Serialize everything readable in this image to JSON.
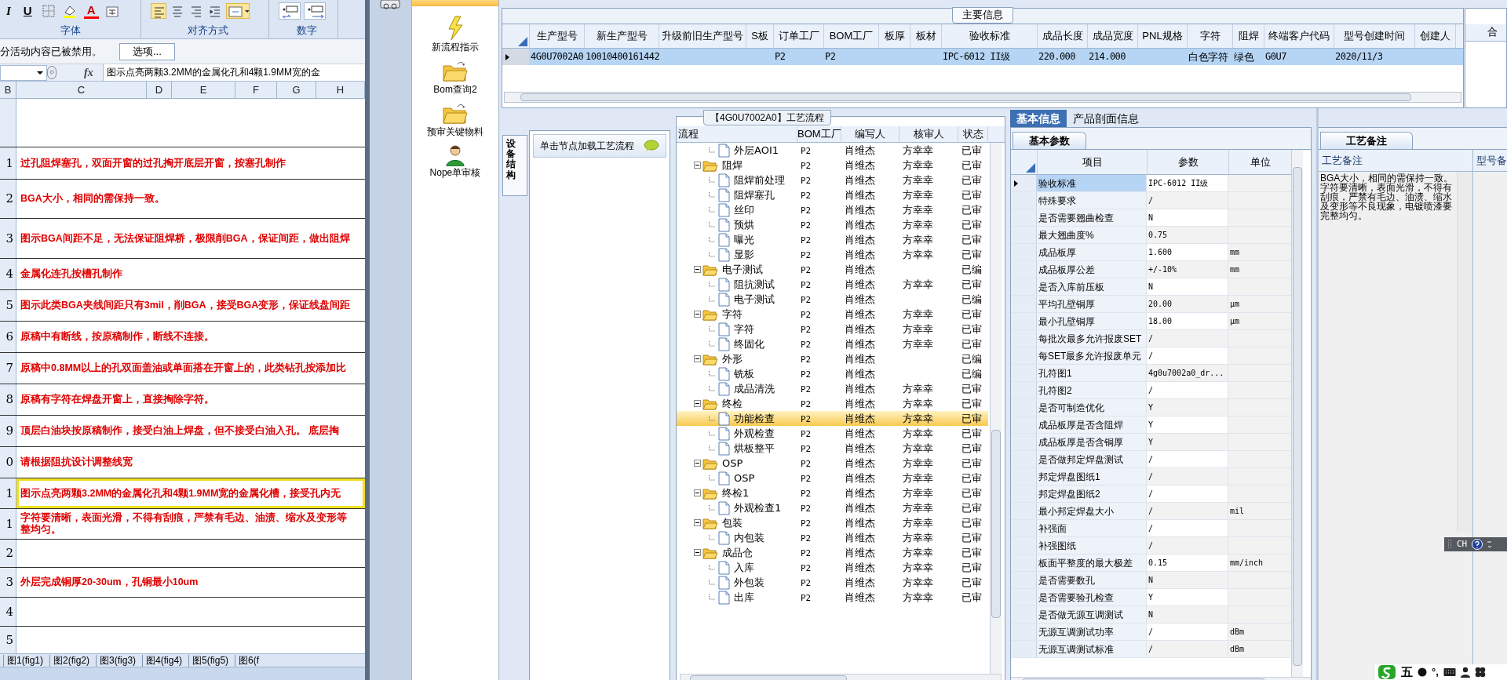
{
  "excel": {
    "format_buttons": [
      "I",
      "U",
      "A"
    ],
    "ribbon_groups": [
      "字体",
      "对齐方式",
      "数字"
    ],
    "security_bar": {
      "message": "分活动内容已被禁用。",
      "button": "选项..."
    },
    "formula_bar": {
      "function_label": "fx",
      "content": "图示点亮两颗3.2MM的金属化孔和4颗1.9MM宽的金"
    },
    "columns": [
      "B",
      "C",
      "D",
      "E",
      "F",
      "G",
      "H"
    ],
    "rows": [
      {
        "header": "",
        "lines": [],
        "selected": false
      },
      {
        "header": "1",
        "lines": [
          "过孔阻焊塞孔，双面开窗的过孔掏开底层开窗，按塞孔制作"
        ],
        "selected": false
      },
      {
        "header": "2",
        "lines": [
          "BGA大小，相同的需保持一致。"
        ],
        "selected": false
      },
      {
        "header": "3",
        "lines": [
          "图示BGA间距不足，无法保证阻焊桥，极限削BGA，保证间距，做出阻焊"
        ],
        "selected": false
      },
      {
        "header": "4",
        "lines": [
          "金属化连孔按槽孔制作"
        ],
        "selected": false
      },
      {
        "header": "5",
        "lines": [
          "图示此类BGA夹线间距只有3mil，削BGA，接受BGA变形，保证线盘间距"
        ],
        "selected": false
      },
      {
        "header": "6",
        "lines": [
          "原稿中有断线，按原稿制作，断线不连接。"
        ],
        "selected": false
      },
      {
        "header": "7",
        "lines": [
          "原稿中0.8MM以上的孔双面盖油或单面搭在开窗上的，此类钻孔按添加比"
        ],
        "selected": false
      },
      {
        "header": "8",
        "lines": [
          "原稿有字符在焊盘开窗上，直接掏除字符。"
        ],
        "selected": false
      },
      {
        "header": "9",
        "lines": [
          "顶层白油块按原稿制作，接受白油上焊盘，但不接受白油入孔。 底层掏"
        ],
        "selected": false
      },
      {
        "header": "0",
        "lines": [
          "请根据阻抗设计调整线宽"
        ],
        "selected": false
      },
      {
        "header": "1",
        "lines": [
          "图示点亮两颗3.2MM的金属化孔和4颗1.9MM宽的金属化槽，接受孔内无"
        ],
        "selected": true
      },
      {
        "header": "1",
        "lines": [
          "字符要清晰，表面光滑，不得有刮痕，严禁有毛边、油渍、缩水及变形等",
          "整均匀。"
        ],
        "selected": false
      },
      {
        "header": "2",
        "lines": [],
        "selected": false
      },
      {
        "header": "3",
        "lines": [
          "外层完成铜厚20-30um，孔铜最小10um"
        ],
        "selected": false
      },
      {
        "header": "4",
        "lines": [],
        "selected": false
      },
      {
        "header": "5",
        "lines": [],
        "selected": false
      }
    ],
    "sheet_tabs": [
      "图1(fig1)",
      "图2(fig2)",
      "图3(fig3)",
      "图4(fig4)",
      "图5(fig5)",
      "图6(f"
    ]
  },
  "nav": {
    "items": [
      {
        "label": "新流程指示",
        "kind": "lightning"
      },
      {
        "label": "Bom查询2",
        "kind": "folder"
      },
      {
        "label": "预审关键物料",
        "kind": "folder"
      },
      {
        "label": "Nope单审核",
        "kind": "person"
      }
    ]
  },
  "main_info": {
    "title": "主要信息",
    "columns": [
      "生产型号",
      "新生产型号",
      "升级前旧生产型号",
      "S板",
      "订单工厂",
      "BOM工厂",
      "板厚",
      "板材",
      "验收标准",
      "成品长度",
      "成品宽度",
      "PNL规格",
      "字符",
      "阻焊",
      "终端客户代码",
      "型号创建时间",
      "创建人"
    ],
    "rows": [
      {
        "cells": [
          "4G0U7002A0",
          "10010400161442",
          "",
          "",
          "P2",
          "P2",
          "",
          "",
          "IPC-6012 II级",
          "220.000",
          "214.000",
          "",
          "白色字符",
          "绿色",
          "G0U7",
          "2020/11/3",
          ""
        ],
        "selected": true
      }
    ],
    "side_header": "合"
  },
  "process_panel": {
    "vertical_tab": "设备结构",
    "hint": "单击节点加载工艺流程"
  },
  "process_flow": {
    "title": "【4G0U7002A0】工艺流程",
    "columns": [
      "流程",
      "BOM工厂",
      "编写人",
      "核审人",
      "状态"
    ],
    "nodes": [
      {
        "children": [
          {
            "label": "外层AOI1",
            "bom": "P2",
            "writer": "肖维杰",
            "reviewer": "方幸幸",
            "status": "已审",
            "selected": false
          }
        ]
      },
      {
        "label": "阻焊",
        "bom": "P2",
        "writer": "肖维杰",
        "reviewer": "方幸幸",
        "status": "已审",
        "selected": false,
        "expanded": true,
        "children": [
          {
            "label": "阻焊前处理",
            "bom": "P2",
            "writer": "肖维杰",
            "reviewer": "方幸幸",
            "status": "已审",
            "selected": false
          },
          {
            "label": "阻焊塞孔",
            "bom": "P2",
            "writer": "肖维杰",
            "reviewer": "方幸幸",
            "status": "已审",
            "selected": false
          },
          {
            "label": "丝印",
            "bom": "P2",
            "writer": "肖维杰",
            "reviewer": "方幸幸",
            "status": "已审",
            "selected": false
          },
          {
            "label": "预烘",
            "bom": "P2",
            "writer": "肖维杰",
            "reviewer": "方幸幸",
            "status": "已审",
            "selected": false
          },
          {
            "label": "曝光",
            "bom": "P2",
            "writer": "肖维杰",
            "reviewer": "方幸幸",
            "status": "已审",
            "selected": false
          },
          {
            "label": "显影",
            "bom": "P2",
            "writer": "肖维杰",
            "reviewer": "方幸幸",
            "status": "已审",
            "selected": false
          }
        ]
      },
      {
        "label": "电子测试",
        "bom": "P2",
        "writer": "肖维杰",
        "status": "已编",
        "selected": false,
        "expanded": true,
        "children": [
          {
            "label": "阻抗测试",
            "bom": "P2",
            "writer": "肖维杰",
            "reviewer": "方幸幸",
            "status": "已审",
            "selected": false
          },
          {
            "label": "电子测试",
            "bom": "P2",
            "writer": "肖维杰",
            "status": "已编",
            "selected": false
          }
        ]
      },
      {
        "label": "字符",
        "bom": "P2",
        "writer": "肖维杰",
        "reviewer": "方幸幸",
        "status": "已审",
        "selected": false,
        "expanded": true,
        "children": [
          {
            "label": "字符",
            "bom": "P2",
            "writer": "肖维杰",
            "reviewer": "方幸幸",
            "status": "已审",
            "selected": false
          },
          {
            "label": "终固化",
            "bom": "P2",
            "writer": "肖维杰",
            "reviewer": "方幸幸",
            "status": "已审",
            "selected": false
          }
        ]
      },
      {
        "label": "外形",
        "bom": "P2",
        "writer": "肖维杰",
        "status": "已编",
        "selected": false,
        "expanded": true,
        "children": [
          {
            "label": "铣板",
            "bom": "P2",
            "writer": "肖维杰",
            "status": "已编",
            "selected": false
          },
          {
            "label": "成品清洗",
            "bom": "P2",
            "writer": "肖维杰",
            "reviewer": "方幸幸",
            "status": "已审",
            "selected": false
          }
        ]
      },
      {
        "label": "终检",
        "bom": "P2",
        "writer": "肖维杰",
        "reviewer": "方幸幸",
        "status": "已审",
        "selected": false,
        "expanded": true,
        "children": [
          {
            "label": "功能检查",
            "bom": "P2",
            "writer": "肖维杰",
            "reviewer": "方幸幸",
            "status": "已审",
            "selected": true
          },
          {
            "label": "外观检查",
            "bom": "P2",
            "writer": "肖维杰",
            "reviewer": "方幸幸",
            "status": "已审",
            "selected": false
          },
          {
            "label": "烘板整平",
            "bom": "P2",
            "writer": "肖维杰",
            "reviewer": "方幸幸",
            "status": "已审",
            "selected": false
          }
        ]
      },
      {
        "label": "OSP",
        "bom": "P2",
        "writer": "肖维杰",
        "reviewer": "方幸幸",
        "status": "已审",
        "selected": false,
        "expanded": true,
        "children": [
          {
            "label": "OSP",
            "bom": "P2",
            "writer": "肖维杰",
            "reviewer": "方幸幸",
            "status": "已审",
            "selected": false
          }
        ]
      },
      {
        "label": "终检1",
        "bom": "P2",
        "writer": "肖维杰",
        "reviewer": "方幸幸",
        "status": "已审",
        "selected": false,
        "expanded": true,
        "children": [
          {
            "label": "外观检查1",
            "bom": "P2",
            "writer": "肖维杰",
            "reviewer": "方幸幸",
            "status": "已审",
            "selected": false
          }
        ]
      },
      {
        "label": "包装",
        "bom": "P2",
        "writer": "肖维杰",
        "reviewer": "方幸幸",
        "status": "已审",
        "selected": false,
        "expanded": true,
        "children": [
          {
            "label": "内包装",
            "bom": "P2",
            "writer": "肖维杰",
            "reviewer": "方幸幸",
            "status": "已审",
            "selected": false
          }
        ]
      },
      {
        "label": "成品仓",
        "bom": "P2",
        "writer": "肖维杰",
        "reviewer": "方幸幸",
        "status": "已审",
        "selected": false,
        "expanded": true,
        "children": [
          {
            "label": "入库",
            "bom": "P2",
            "writer": "肖维杰",
            "reviewer": "方幸幸",
            "status": "已审",
            "selected": false
          },
          {
            "label": "外包装",
            "bom": "P2",
            "writer": "肖维杰",
            "reviewer": "方幸幸",
            "status": "已审",
            "selected": false
          },
          {
            "label": "出库",
            "bom": "P2",
            "writer": "肖维杰",
            "reviewer": "方幸幸",
            "status": "已审",
            "selected": false
          }
        ]
      }
    ]
  },
  "params": {
    "tabs": [
      {
        "label": "基本信息",
        "selected": true
      },
      {
        "label": "产品剖面信息",
        "selected": false
      }
    ],
    "section_tab": "基本参数",
    "columns": [
      "项目",
      "参数",
      "单位"
    ],
    "rows": [
      {
        "item": "验收标准",
        "value": "IPC-6012 II级",
        "unit": "",
        "selected": true
      },
      {
        "item": "特殊要求",
        "value": "/",
        "unit": "",
        "selected": false
      },
      {
        "item": "是否需要翘曲检查",
        "value": "N",
        "unit": "",
        "selected": false
      },
      {
        "item": "最大翘曲度%",
        "value": "0.75",
        "unit": "",
        "selected": false
      },
      {
        "item": "成品板厚",
        "value": "1.600",
        "unit": "mm",
        "selected": false
      },
      {
        "item": "成品板厚公差",
        "value": "+/-10%",
        "unit": "mm",
        "selected": false
      },
      {
        "item": "是否入库前压板",
        "value": "N",
        "unit": "",
        "selected": false
      },
      {
        "item": "平均孔壁铜厚",
        "value": "20.00",
        "unit": "μm",
        "selected": false
      },
      {
        "item": "最小孔壁铜厚",
        "value": "18.00",
        "unit": "μm",
        "selected": false
      },
      {
        "item": "每批次最多允许报废SET",
        "value": "/",
        "unit": "",
        "selected": false
      },
      {
        "item": "每SET最多允许报废单元",
        "value": "/",
        "unit": "",
        "selected": false
      },
      {
        "item": "孔符图1",
        "value": "4g0u7002a0_dr...",
        "unit": "",
        "selected": false
      },
      {
        "item": "孔符图2",
        "value": "/",
        "unit": "",
        "selected": false
      },
      {
        "item": "是否可制造优化",
        "value": "Y",
        "unit": "",
        "selected": false
      },
      {
        "item": "成品板厚是否含阻焊",
        "value": "Y",
        "unit": "",
        "selected": false
      },
      {
        "item": "成品板厚是否含铜厚",
        "value": "Y",
        "unit": "",
        "selected": false
      },
      {
        "item": "是否做邦定焊盘测试",
        "value": "/",
        "unit": "",
        "selected": false
      },
      {
        "item": "邦定焊盘图纸1",
        "value": "/",
        "unit": "",
        "selected": false
      },
      {
        "item": "邦定焊盘图纸2",
        "value": "/",
        "unit": "",
        "selected": false
      },
      {
        "item": "最小邦定焊盘大小",
        "value": "/",
        "unit": "mil",
        "selected": false
      },
      {
        "item": "补强面",
        "value": "/",
        "unit": "",
        "selected": false
      },
      {
        "item": "补强图纸",
        "value": "/",
        "unit": "",
        "selected": false
      },
      {
        "item": "板面平整度的最大极差",
        "value": "0.15",
        "unit": "mm/inch",
        "selected": false
      },
      {
        "item": "是否需要数孔",
        "value": "N",
        "unit": "",
        "selected": false
      },
      {
        "item": "是否需要验孔检查",
        "value": "Y",
        "unit": "",
        "selected": false
      },
      {
        "item": "是否做无源互调测试",
        "value": "N",
        "unit": "",
        "selected": false
      },
      {
        "item": "无源互调测试功率",
        "value": "/",
        "unit": "dBm",
        "selected": false
      },
      {
        "item": "无源互调测试标准",
        "value": "/",
        "unit": "dBm",
        "selected": false
      }
    ]
  },
  "notes": {
    "section_tab": "工艺备注",
    "columns": [
      "工艺备注",
      "型号备"
    ],
    "text": "BGA大小，相同的需保持一致。字符要清晰，表面光滑，不得有刮痕，严禁有毛边、油渍、缩水及变形等不良现象，电镀喷漆要完整均匀。"
  },
  "ime": {
    "language": "CH"
  },
  "tray": {
    "input_mode": "五",
    "punctuation": "°,"
  }
}
